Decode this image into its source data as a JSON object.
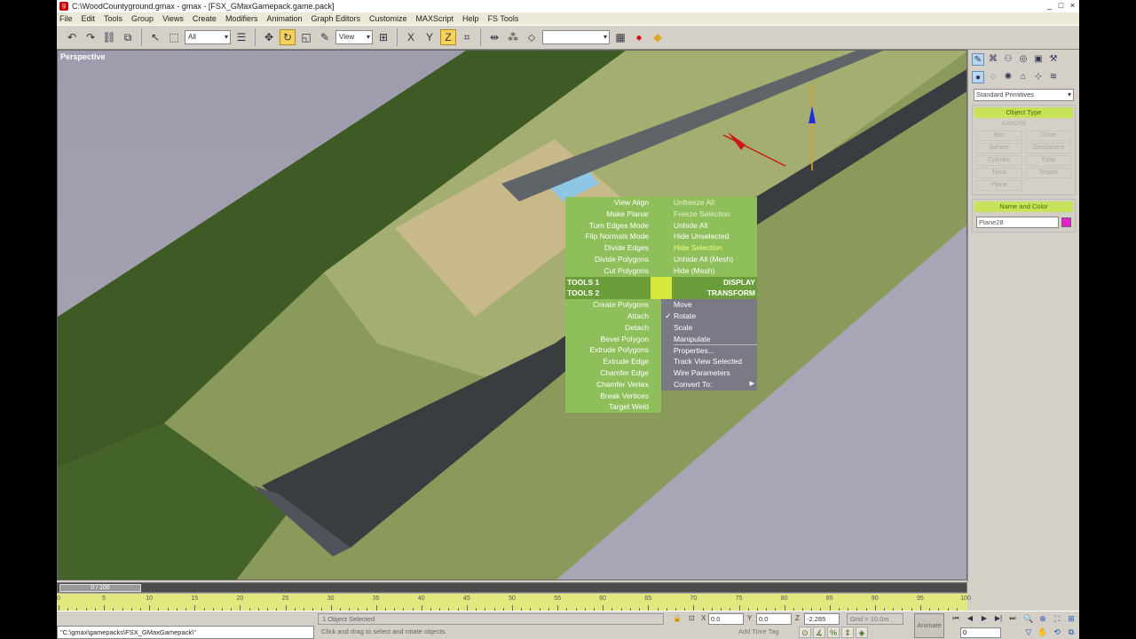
{
  "window": {
    "title": "C:\\WoodCountyground.gmax - gmax - [FSX_GMaxGamepack.game.pack]",
    "controls": [
      "_",
      "□",
      "×"
    ]
  },
  "menu": [
    "File",
    "Edit",
    "Tools",
    "Group",
    "Views",
    "Create",
    "Modifiers",
    "Animation",
    "Graph Editors",
    "Customize",
    "MAXScript",
    "Help",
    "FS Tools"
  ],
  "toolbar": {
    "selection_filter": "All",
    "ref_coord": "View"
  },
  "viewport": {
    "label": "Perspective"
  },
  "quad_menu": {
    "top_left": [
      "View Align",
      "Make Planar",
      "Turn Edges Mode",
      "Flip Normals Mode",
      "Divide Edges",
      "Divide Polygons",
      "Cut Polygons"
    ],
    "top_right": [
      "Unfreeze All",
      "Freeze Selection",
      "Unhide All",
      "Hide Unselected",
      "Hide Selection",
      "Unhide All (Mesh)",
      "Hide (Mesh)"
    ],
    "tools1": "TOOLS 1",
    "display": "DISPLAY",
    "tools2": "TOOLS 2",
    "transform": "TRANSFORM",
    "bottom_left": [
      "Create Polygons",
      "Attach",
      "Detach",
      "Bevel Polygon",
      "Extrude Polygons",
      "Extrude Edge",
      "Chamfer Edge",
      "Chamfer Vertex",
      "Break Vertices",
      "Target Weld"
    ],
    "bottom_right": [
      "Move",
      "Rotate",
      "Scale",
      "Manipulate",
      "Properties...",
      "Track View Selected",
      "Wire Parameters",
      "Convert To:"
    ],
    "checked_item": "Rotate"
  },
  "command_panel": {
    "category": "Standard Primitives",
    "rollout_object_type": "Object Type",
    "autogrid": "AutoGrid",
    "primitives": [
      "Box",
      "Cone",
      "Sphere",
      "GeoSphere",
      "Cylinder",
      "Tube",
      "Torus",
      "Teapot",
      "Plane"
    ],
    "rollout_name": "Name and Color",
    "object_name": "Plane28",
    "object_color": "#e81fcf"
  },
  "time_slider": {
    "position_label": "0 / 100"
  },
  "timeline": {
    "ticks": [
      "0",
      "5",
      "10",
      "15",
      "20",
      "25",
      "30",
      "35",
      "40",
      "45",
      "50",
      "55",
      "60",
      "65",
      "70",
      "75",
      "80",
      "85",
      "90",
      "95",
      "100"
    ]
  },
  "status": {
    "maxscript": "\"C:\\gmax\\gamepacks\\FSX_GMaxGamepack\\\"",
    "selected": "1 Object Selected",
    "prompt": "Click and drag to select and rotate objects",
    "x": "0.0",
    "y": "0.0",
    "z": "-2.285",
    "grid": "Grid = 10.0m",
    "add_time_tag": "Add Time Tag",
    "animate": "Animate",
    "frame": "0"
  }
}
